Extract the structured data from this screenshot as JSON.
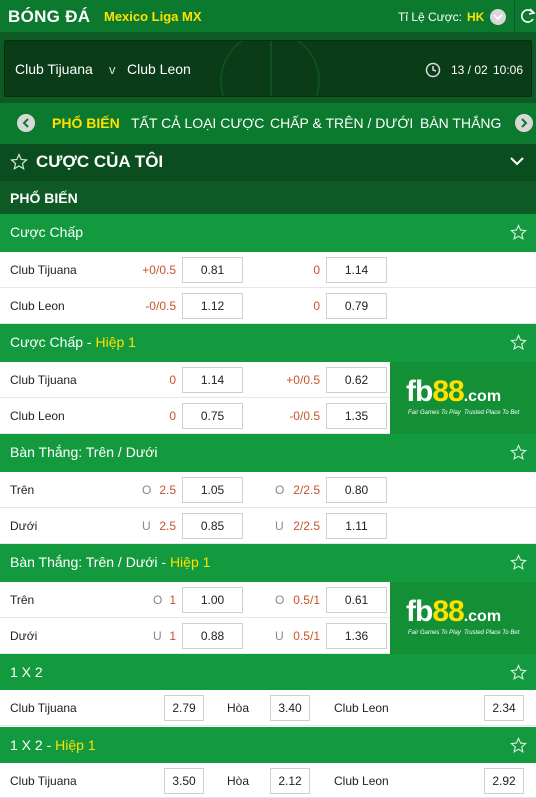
{
  "header": {
    "title": "BÓNG ĐÁ",
    "league": "Mexico Liga MX",
    "odds_label": "Tỉ Lệ Cược:",
    "odds_format": "HK"
  },
  "match": {
    "home": "Club Tijuana",
    "vs": "v",
    "away": "Club Leon",
    "date": "13 / 02",
    "time": "10:06"
  },
  "tabs": [
    "PHỔ BIẾN",
    "TẤT CẢ LOẠI CƯỢC",
    "CHẤP & TRÊN / DƯỚI",
    "BÀN THẮNG"
  ],
  "my_bets": "CƯỢC CỦA TÔI",
  "popular": "PHỔ BIẾN",
  "sections": [
    {
      "title": "Cược Chấp",
      "highlight": "",
      "rows": [
        {
          "label": "Club Tijuana",
          "hc1": "+0/0.5",
          "o1": "0.81",
          "hc2": "0",
          "o2": "1.14"
        },
        {
          "label": "Club Leon",
          "hc1": "-0/0.5",
          "o1": "1.12",
          "hc2": "0",
          "o2": "0.79"
        }
      ]
    },
    {
      "title": "Cược Chấp",
      "highlight": "Hiệp 1",
      "rows": [
        {
          "label": "Club Tijuana",
          "hc1": "0",
          "o1": "1.14",
          "hc2": "+0/0.5",
          "o2": "0.62"
        },
        {
          "label": "Club Leon",
          "hc1": "0",
          "o1": "0.75",
          "hc2": "-0/0.5",
          "o2": "1.35"
        }
      ]
    },
    {
      "title": "Bàn Thắng: Trên / Dưới",
      "highlight": "",
      "rows": [
        {
          "label": "Trên",
          "p1": "O",
          "hc1": "2.5",
          "o1": "1.05",
          "p2": "O",
          "hc2": "2/2.5",
          "o2": "0.80"
        },
        {
          "label": "Dưới",
          "p1": "U",
          "hc1": "2.5",
          "o1": "0.85",
          "p2": "U",
          "hc2": "2/2.5",
          "o2": "1.11"
        }
      ]
    },
    {
      "title": "Bàn Thắng: Trên / Dưới",
      "highlight": "Hiệp 1",
      "rows": [
        {
          "label": "Trên",
          "p1": "O",
          "hc1": "1",
          "o1": "1.00",
          "p2": "O",
          "hc2": "0.5/1",
          "o2": "0.61"
        },
        {
          "label": "Dưới",
          "p1": "U",
          "hc1": "1",
          "o1": "0.88",
          "p2": "U",
          "hc2": "0.5/1",
          "o2": "1.36"
        }
      ]
    },
    {
      "title": "1 X 2",
      "highlight": "",
      "row": {
        "home": "Club Tijuana",
        "o1": "2.79",
        "draw": "Hòa",
        "ox": "3.40",
        "away": "Club Leon",
        "o2": "2.34"
      }
    },
    {
      "title": "1 X 2",
      "highlight": "Hiệp 1",
      "row": {
        "home": "Club Tijuana",
        "o1": "3.50",
        "draw": "Hòa",
        "ox": "2.12",
        "away": "Club Leon",
        "o2": "2.92"
      }
    }
  ],
  "ad": {
    "brand": "fb",
    "brand_num": "88",
    "brand_tld": ".com",
    "tagline1": "Fair Games To Play",
    "tagline2": "Trusted Place To Bet"
  },
  "icons": [
    "chevron-down-icon",
    "refresh-icon",
    "clock-icon",
    "chevron-left-icon",
    "chevron-right-icon",
    "star-icon"
  ],
  "colors": {
    "primary_green": "#0b7a2e",
    "section_green": "#149a3e",
    "dark_green": "#0a4d1f",
    "accent_yellow": "#ffe100",
    "handicap_orange": "#c8532b"
  }
}
